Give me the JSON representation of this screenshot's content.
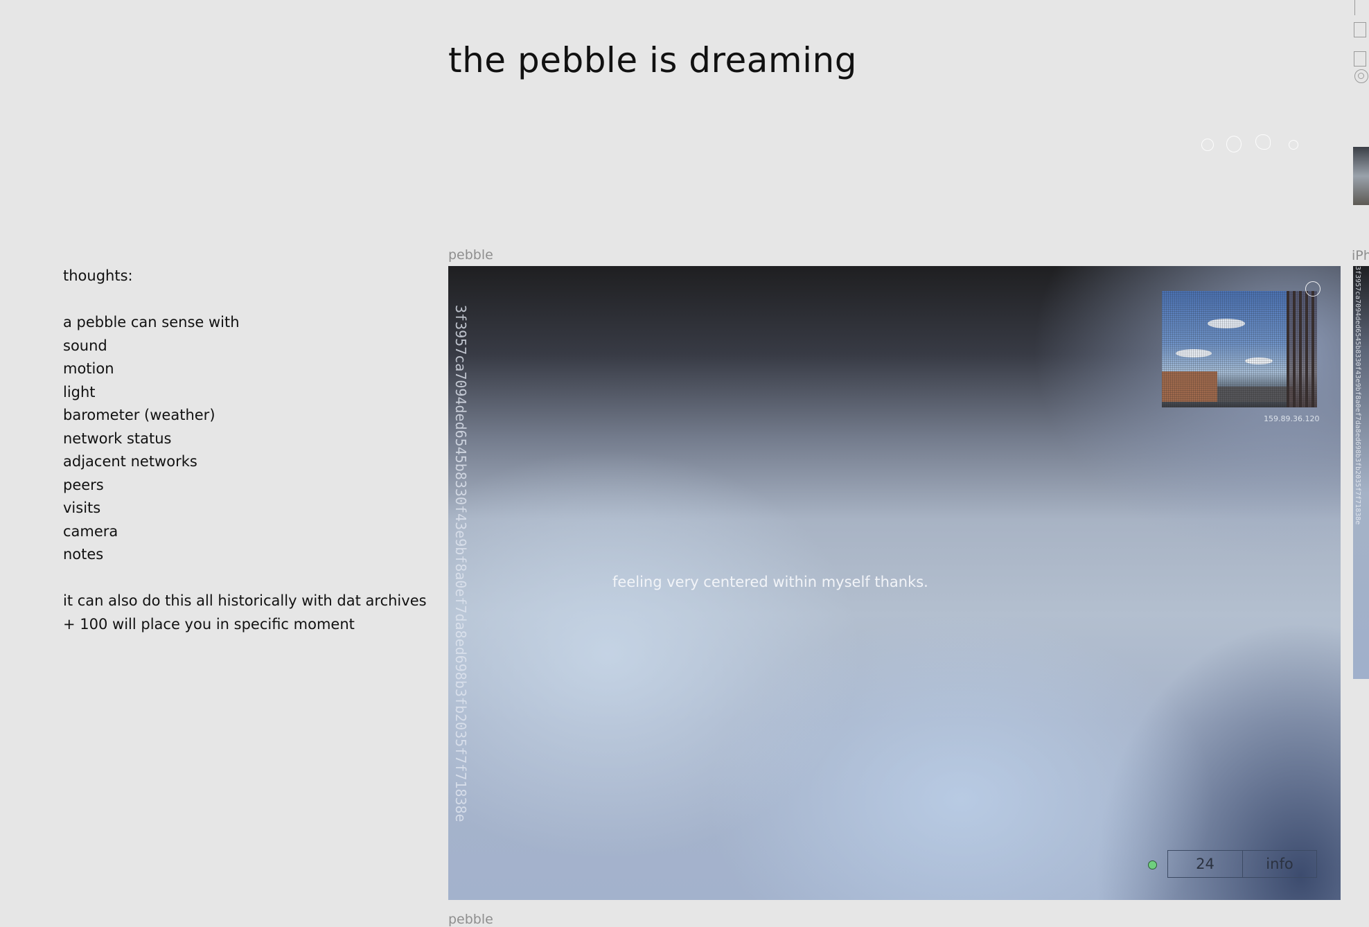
{
  "header": {
    "title": "the pebble is dreaming"
  },
  "thoughts": {
    "lines": [
      "thoughts:",
      "",
      "a pebble can sense with",
      "sound",
      "motion",
      "light",
      "barometer (weather)",
      "network status",
      "adjacent networks",
      "peers",
      "visits",
      "camera",
      "notes",
      "",
      "it can also do this all historically with dat archives",
      "+ 100 will place you in specific moment"
    ]
  },
  "pebble_card": {
    "label": "pebble",
    "hash": "3f3957ca7094ded6545b8330f43e9bf8a0ef7da8ed698b3fb2035f7f71838e",
    "mood": "feeling very centered within myself thanks.",
    "camera_ip": "159.89.36.120",
    "status_color": "#6fcf7e",
    "controls": {
      "count": "24",
      "info_label": "info"
    }
  },
  "next_card": {
    "label": "pebble"
  },
  "side_card": {
    "label": "iPh",
    "hash": "3f3957ca7094ded6545b8330f43e9bf8a0ef7da8ed698b3fb2035f7f71838e"
  }
}
